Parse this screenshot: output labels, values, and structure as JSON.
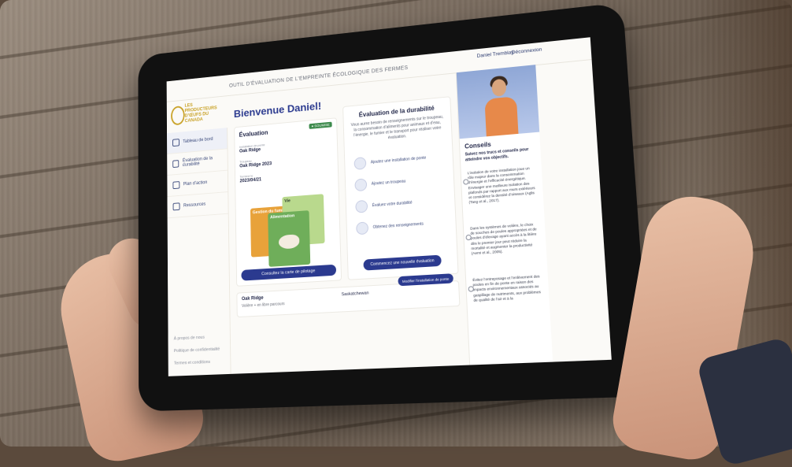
{
  "tool_title": "OUTIL D’ÉVALUATION DE L’EMPREINTE ÉCOLOGIQUE DES FERMES",
  "user_name": "Daniel Tremblay",
  "logout_label": "Déconnexion",
  "logo_text": "LES PRODUCTEURS D’ŒUFS DU CANADA",
  "welcome": "Bienvenue Daniel!",
  "sidebar": {
    "items": [
      {
        "label": "Tableau de bord"
      },
      {
        "label": "Évaluation de la durabilité"
      },
      {
        "label": "Plan d’action"
      },
      {
        "label": "Ressources"
      }
    ],
    "footer": [
      "À propos de nous",
      "Politique de confidentialité",
      "Termes et conditions"
    ]
  },
  "evaluation_card": {
    "title": "Évaluation",
    "badge": "● SOUMISE",
    "farm_label": "Installation de ponte",
    "farm_value": "Oak Ridge",
    "period_label": "Troupeau",
    "period_value": "Oak Ridge 2023",
    "date_label": "Terminé le",
    "date_value": "2023/04/21",
    "tiles": [
      "Gestion du fumier",
      "Alimentation",
      "Vie"
    ],
    "map_button": "Consultez la carte de pilotage"
  },
  "durability_card": {
    "title": "Évaluation de la durabilité",
    "description": "Vous aurez besoin de renseignements sur le troupeau, la consommation d’aliments pour animaux et d’eau, l’énergie, le fumier et le transport pour réaliser votre évaluation.",
    "steps": [
      "Ajoutez une installation de ponte",
      "Ajoutez un troupeau",
      "Évaluez votre durabilité",
      "Obtenez des renseignements"
    ],
    "start_button": "Commencez une nouvelle évaluation"
  },
  "farm_bar": {
    "name": "Oak Ridge",
    "sub": "Volière + en libre parcours",
    "province": "Saskatchewan",
    "edit_button": "Modifier l’installation de ponte"
  },
  "tips": {
    "title": "Conseils",
    "subtitle": "Suivez nos trucs et conseils pour atteindre vos objectifs.",
    "items": [
      "L’isolation de votre installation joue un rôle majeur dans la consommation d’énergie et l’efficacité énergétique. Envisager une meilleure isolation des plafonds par rapport aux murs extérieurs et considérez la densité d’oiseaux (Aglis (Tang et al., 2017).",
      "Dans les systèmes de volière, le choix de souches de poules appropriées et de poules d’élevage ayant accès à la litière dès le premier jour peut réduire la mortalité et augmenter la productivité (Aerni et al., 2005).",
      "Évitez l’entreposage et l’enlèvement des poules en fin de ponte en raison des impacts environnementaux associés au gaspillage de nutriments, aux problèmes de qualité de l’air et à la"
    ]
  }
}
